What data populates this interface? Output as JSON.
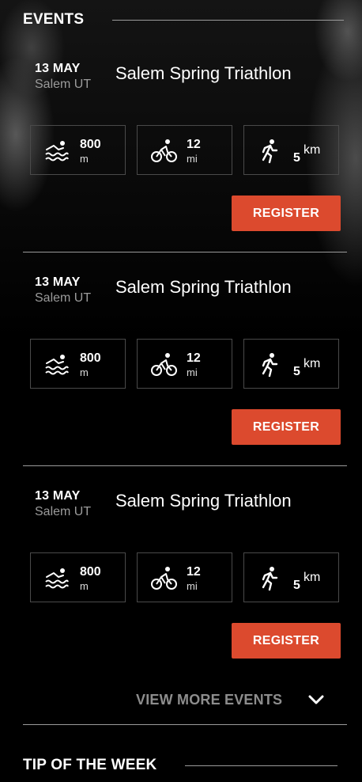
{
  "events_section": {
    "title": "EVENTS"
  },
  "events": [
    {
      "date": "13 MAY",
      "location": "Salem UT",
      "name": "Salem Spring Triathlon",
      "swim": {
        "value": "800",
        "unit": "m",
        "icon": "swim-icon"
      },
      "bike": {
        "value": "12",
        "unit": "mi",
        "icon": "bike-icon"
      },
      "run": {
        "value": "5",
        "unit": "km",
        "icon": "run-icon"
      },
      "register_label": "REGISTER"
    },
    {
      "date": "13 MAY",
      "location": "Salem UT",
      "name": "Salem Spring Triathlon",
      "swim": {
        "value": "800",
        "unit": "m",
        "icon": "swim-icon"
      },
      "bike": {
        "value": "12",
        "unit": "mi",
        "icon": "bike-icon"
      },
      "run": {
        "value": "5",
        "unit": "km",
        "icon": "run-icon"
      },
      "register_label": "REGISTER"
    },
    {
      "date": "13 MAY",
      "location": "Salem UT",
      "name": "Salem Spring Triathlon",
      "swim": {
        "value": "800",
        "unit": "m",
        "icon": "swim-icon"
      },
      "bike": {
        "value": "12",
        "unit": "mi",
        "icon": "bike-icon"
      },
      "run": {
        "value": "5",
        "unit": "km",
        "icon": "run-icon"
      },
      "register_label": "REGISTER"
    }
  ],
  "view_more": {
    "label": "VIEW MORE EVENTS",
    "icon": "chevron-down-icon"
  },
  "tip_section": {
    "title": "TIP OF THE WEEK"
  },
  "colors": {
    "accent": "#dc4a2e",
    "background": "#000000",
    "muted_text": "#9b9b9b",
    "divider": "#9a9a9a"
  }
}
